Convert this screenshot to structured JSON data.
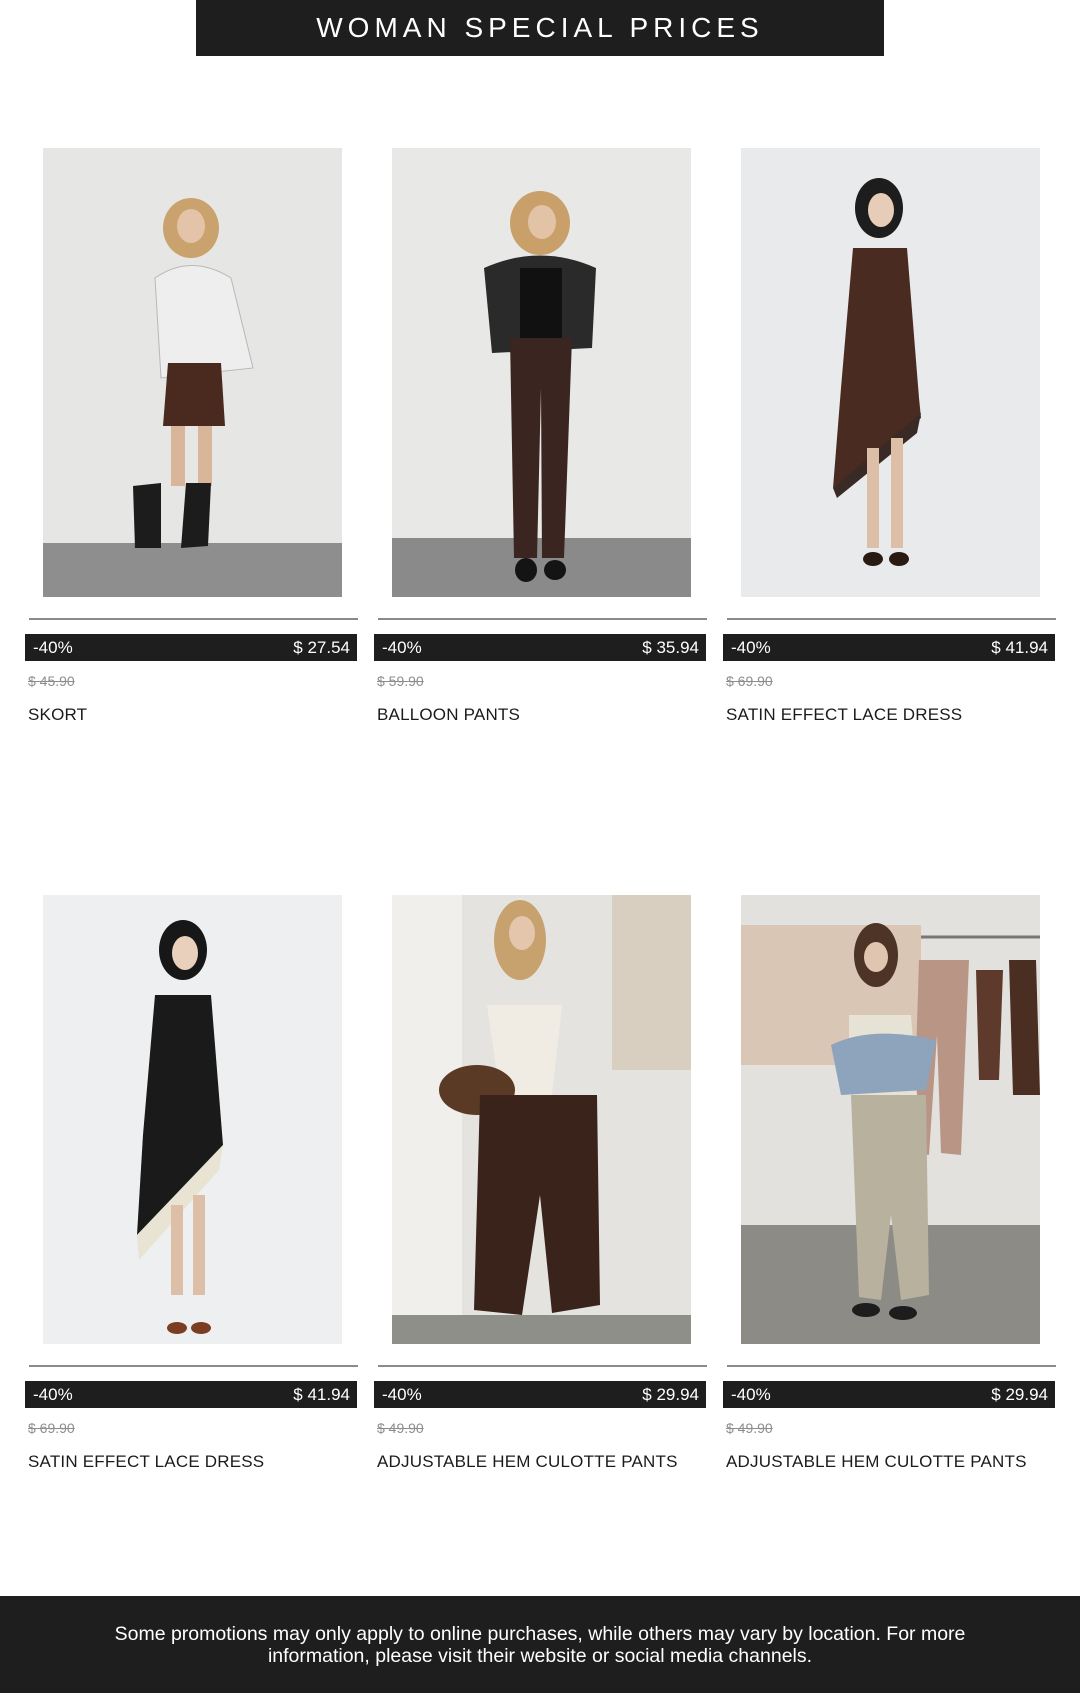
{
  "banner": {
    "title": "WOMAN SPECIAL PRICES"
  },
  "products": [
    {
      "discount": "-40%",
      "price": "$ 27.54",
      "old_price": "$ 45.90",
      "name": "SKORT"
    },
    {
      "discount": "-40%",
      "price": "$ 35.94",
      "old_price": "$ 59.90",
      "name": "BALLOON PANTS"
    },
    {
      "discount": "-40%",
      "price": "$ 41.94",
      "old_price": "$ 69.90",
      "name": "SATIN EFFECT LACE DRESS"
    },
    {
      "discount": "-40%",
      "price": "$ 41.94",
      "old_price": "$ 69.90",
      "name": "SATIN EFFECT LACE DRESS"
    },
    {
      "discount": "-40%",
      "price": "$ 29.94",
      "old_price": "$ 49.90",
      "name": "ADJUSTABLE HEM CULOTTE PANTS"
    },
    {
      "discount": "-40%",
      "price": "$ 29.94",
      "old_price": "$ 49.90",
      "name": "ADJUSTABLE HEM CULOTTE PANTS"
    }
  ],
  "footer": {
    "note": "Some promotions may only apply to online purchases, while others may vary by location. For more information, please visit their website or social media channels."
  }
}
